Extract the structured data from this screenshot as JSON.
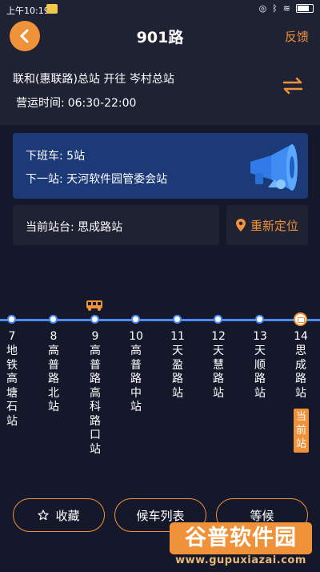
{
  "status_bar": {
    "time": "上午10:19"
  },
  "header": {
    "title": "901路",
    "feedback_label": "反馈"
  },
  "route": {
    "line": "联和(惠联路)总站 开往 岑村总站",
    "hours_label": "营运时间:",
    "hours_value": "06:30-22:00"
  },
  "next_bus": {
    "count_text": "下班车: 5站",
    "next_stop_text": "下一站: 天河软件园管委会站"
  },
  "current_stop": {
    "text": "当前站台: 思成路站",
    "relocate_label": "重新定位"
  },
  "stops": [
    {
      "number": "7",
      "name": "地铁高塘石站"
    },
    {
      "number": "8",
      "name": "高普路北站"
    },
    {
      "number": "9",
      "name": "高普路高科路口站"
    },
    {
      "number": "10",
      "name": "高普路中站"
    },
    {
      "number": "11",
      "name": "天盈路站"
    },
    {
      "number": "12",
      "name": "天慧路站"
    },
    {
      "number": "13",
      "name": "天顺路站"
    },
    {
      "number": "14",
      "name": "思成路站"
    }
  ],
  "current_stop_tag": "当前站",
  "buttons": {
    "favorite": "收藏",
    "bus_list": "候车列表",
    "wait": "等候"
  },
  "watermark": {
    "title": "谷普软件园",
    "url": "www.gupuxiazai.com"
  },
  "colors": {
    "accent": "#f0923a",
    "route": "#4a8bf5",
    "background": "#15182a",
    "card": "#1e2233",
    "highlight_card": "#1c3a78"
  }
}
